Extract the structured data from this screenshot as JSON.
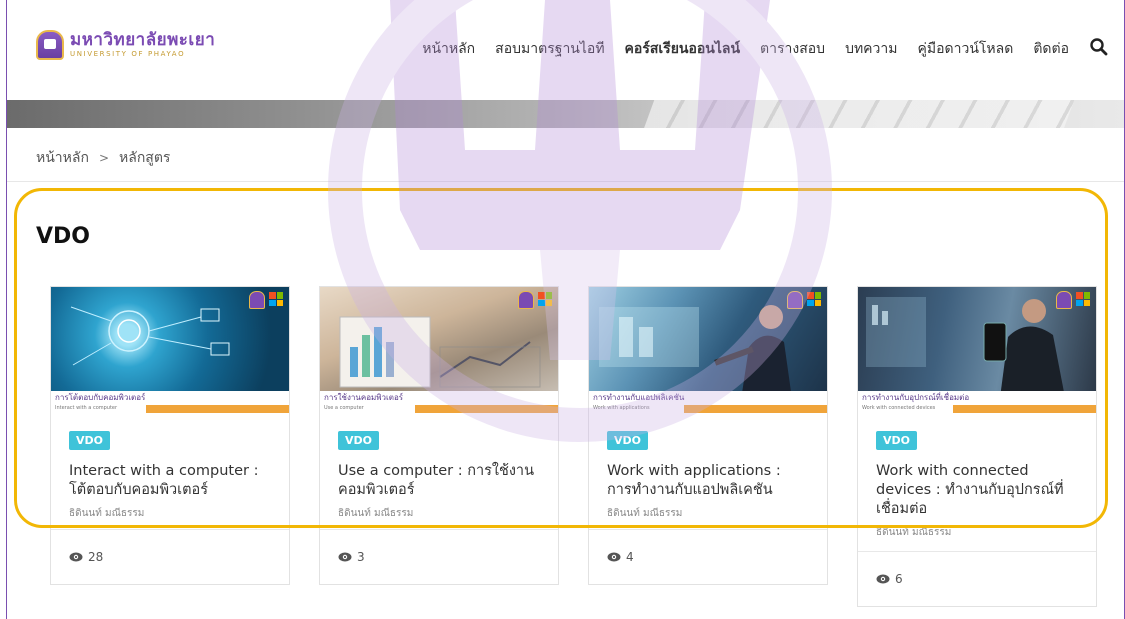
{
  "header": {
    "logo_th": "มหาวิทยาลัยพะเยา",
    "logo_en": "UNIVERSITY OF PHAYAO",
    "nav": [
      {
        "label": "หน้าหลัก"
      },
      {
        "label": "สอบมาตรฐานไอที"
      },
      {
        "label": "คอร์สเรียนออนไลน์"
      },
      {
        "label": "ตารางสอบ"
      },
      {
        "label": "บทความ"
      },
      {
        "label": "คู่มือดาวน์โหลด"
      },
      {
        "label": "ติดต่อ"
      }
    ]
  },
  "breadcrumb": {
    "home": "หน้าหลัก",
    "separator": ">",
    "current": "หลักสูตร"
  },
  "section": {
    "title": "VDO"
  },
  "cards": [
    {
      "thumb_title": "การโต้ตอบกับคอมพิวเตอร์",
      "thumb_sub": "Interact with a computer",
      "badge": "VDO",
      "title": "Interact with a computer : โต้ตอบกับคอมพิวเตอร์",
      "author": "ธิดินนท์ มณีธรรม",
      "views": "28"
    },
    {
      "thumb_title": "การใช้งานคอมพิวเตอร์",
      "thumb_sub": "Use a computer",
      "badge": "VDO",
      "title": "Use a computer : การใช้งานคอมพิวเตอร์",
      "author": "ธิดินนท์ มณีธรรม",
      "views": "3"
    },
    {
      "thumb_title": "การทำงานกับแอปพลิเคชัน",
      "thumb_sub": "Work with applications",
      "badge": "VDO",
      "title": "Work with applications : การทำงานกับแอปพลิเคชัน",
      "author": "ธิดินนท์ มณีธรรม",
      "views": "4"
    },
    {
      "thumb_title": "การทำงานกับอุปกรณ์ที่เชื่อมต่อ",
      "thumb_sub": "Work with connected devices",
      "badge": "VDO",
      "title": "Work with connected devices : ทำงานกับอุปกรณ์ที่เชื่อมต่อ",
      "author": "ธิดินนท์ มณีธรรม",
      "views": "6"
    }
  ],
  "colors": {
    "brand": "#7b4bb3",
    "badge": "#3fc3d9",
    "highlight": "#f2b705"
  }
}
